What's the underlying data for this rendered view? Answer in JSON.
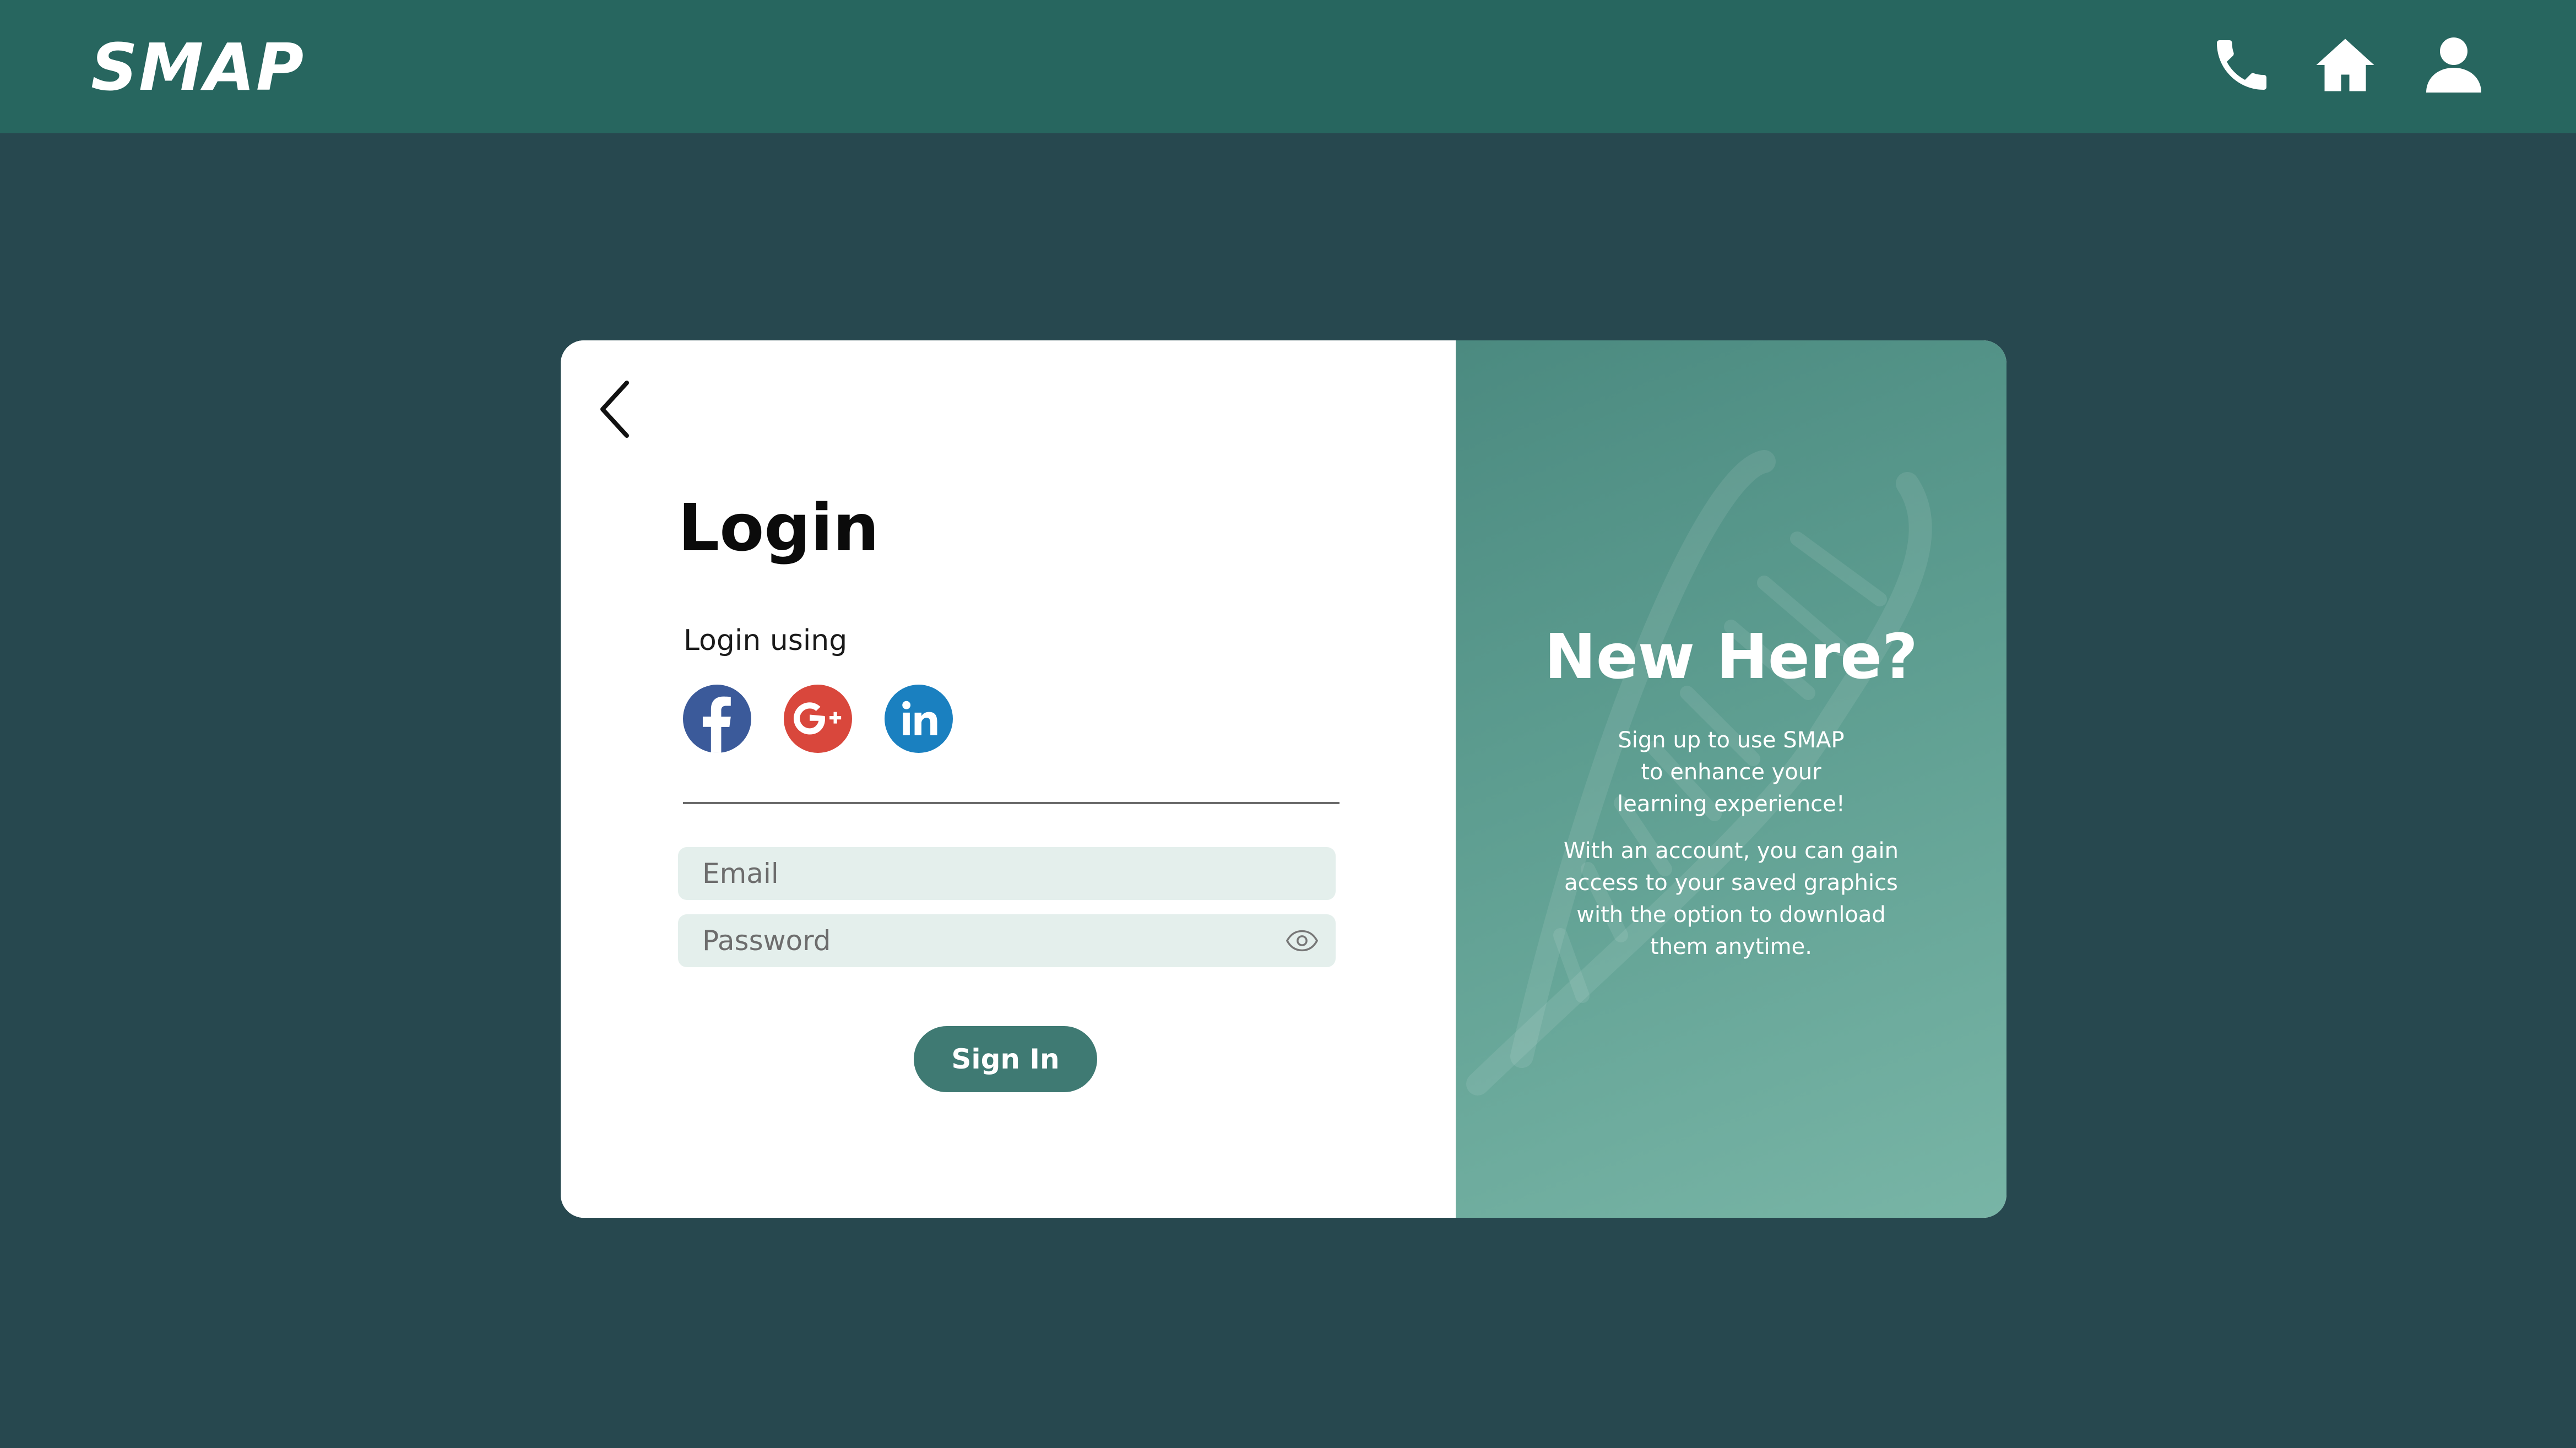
{
  "header": {
    "logo": "SMAP",
    "icons": [
      "phone-icon",
      "home-icon",
      "user-icon"
    ]
  },
  "login": {
    "title": "Login",
    "login_using": "Login using",
    "social": [
      "facebook-icon",
      "google-plus-icon",
      "linkedin-icon"
    ],
    "email_placeholder": "Email",
    "password_placeholder": "Password",
    "signin_label": "Sign In"
  },
  "signup_panel": {
    "title": "New Here?",
    "blurb_1": "Sign up to use SMAP\nto enhance your\nlearning experience!",
    "blurb_2": "With an account, you can gain\naccess to your saved graphics\nwith the option to download\nthem anytime."
  },
  "colors": {
    "background": "#27484f",
    "header": "#27665f",
    "accent": "#3f7a73",
    "panel_gradient_start": "#4b8a80",
    "panel_gradient_end": "#78b5a6",
    "input_bg": "#e4efec"
  }
}
